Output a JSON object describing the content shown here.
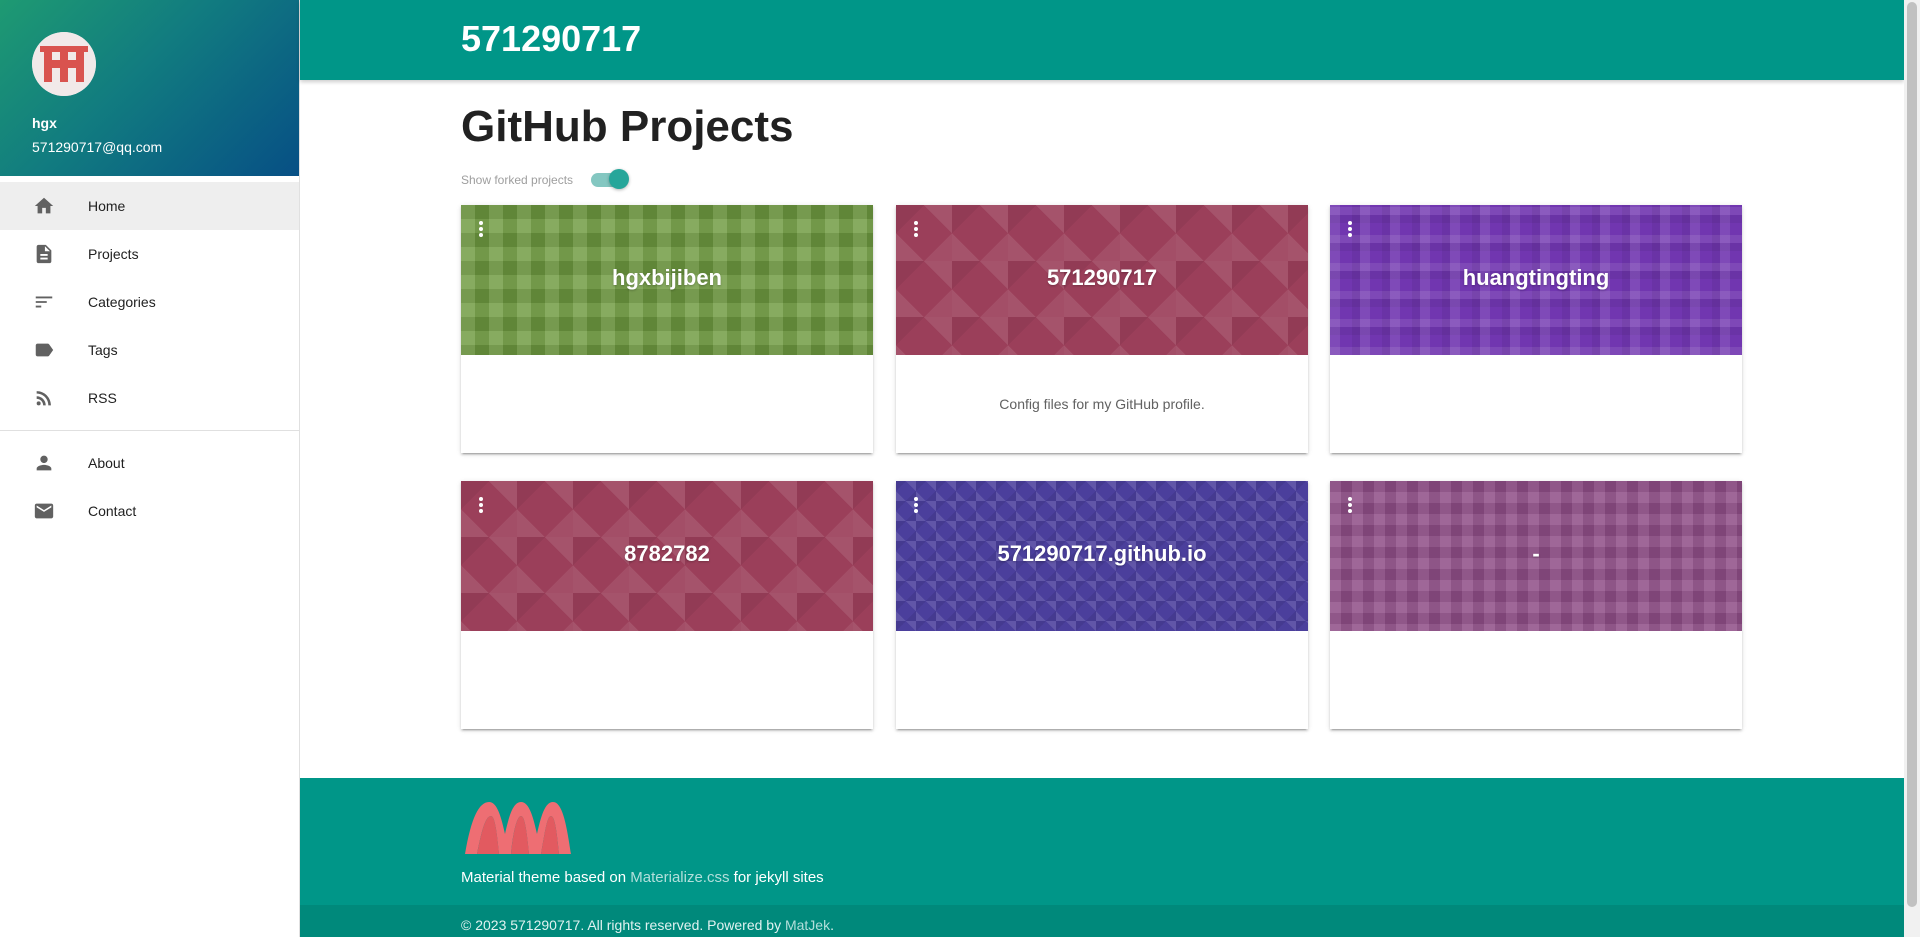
{
  "user": {
    "name": "hgx",
    "email": "571290717@qq.com"
  },
  "nav": {
    "primary": [
      {
        "label": "Home",
        "icon": "home-icon"
      },
      {
        "label": "Projects",
        "icon": "document-icon"
      },
      {
        "label": "Categories",
        "icon": "sort-icon"
      },
      {
        "label": "Tags",
        "icon": "tag-icon"
      },
      {
        "label": "RSS",
        "icon": "rss-icon"
      }
    ],
    "secondary": [
      {
        "label": "About",
        "icon": "person-icon"
      },
      {
        "label": "Contact",
        "icon": "mail-icon"
      }
    ]
  },
  "header": {
    "title": "571290717"
  },
  "main": {
    "heading": "GitHub Projects",
    "fork_toggle_label": "Show forked projects",
    "fork_toggle_on": true,
    "projects": [
      {
        "title": "hgxbijiben",
        "description": "",
        "color": "#6e993f"
      },
      {
        "title": "571290717",
        "description": "Config files for my GitHub profile.",
        "color": "#9b3f5a"
      },
      {
        "title": "huangtingting",
        "description": "",
        "color": "#7136b0"
      },
      {
        "title": "8782782",
        "description": "",
        "color": "#9b3f5a"
      },
      {
        "title": "571290717.github.io",
        "description": "",
        "color": "#4b3f9c"
      },
      {
        "title": "-",
        "description": "",
        "color": "#8f4e87"
      }
    ]
  },
  "footer": {
    "text_before": "Material theme based on",
    "link1": "Materialize.css",
    "text_after": "for jekyll sites",
    "copyright_prefix": "© 2023 571290717. All rights reserved. Powered by",
    "link2": "MatJek",
    "copyright_suffix": "."
  },
  "colors": {
    "primary": "#009688",
    "accent": "#26a69a"
  }
}
